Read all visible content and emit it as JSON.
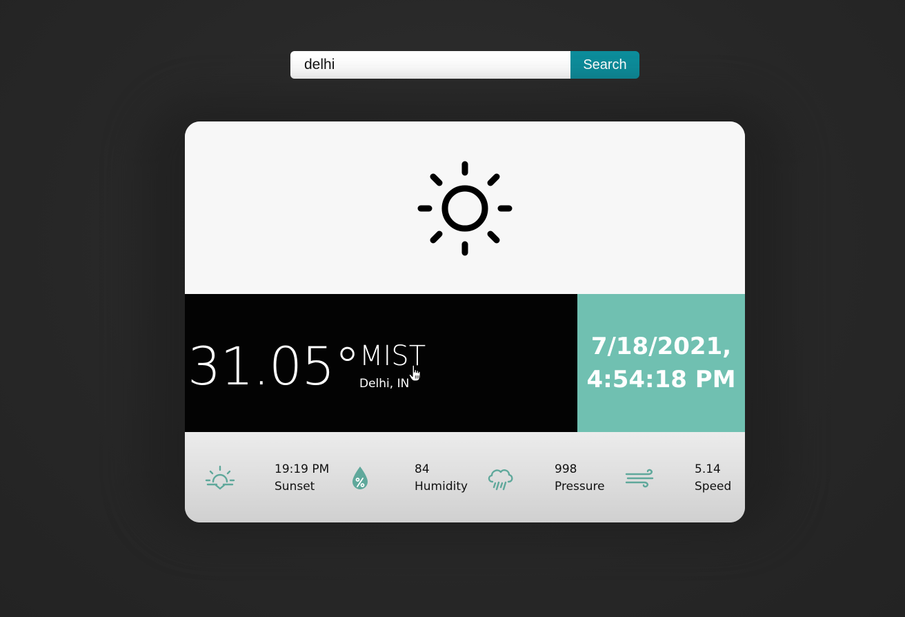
{
  "search": {
    "value": "delhi",
    "button_label": "Search"
  },
  "weather": {
    "icon": "sun-icon",
    "temperature": "31.05°",
    "condition": "MIST",
    "location": "Delhi, IN",
    "date": "7/18/2021,",
    "time": "4:54:18 PM"
  },
  "stats": [
    {
      "icon": "sunset-icon",
      "value": "19:19 PM",
      "label": "Sunset"
    },
    {
      "icon": "humidity-icon",
      "value": "84",
      "label": "Humidity"
    },
    {
      "icon": "pressure-icon",
      "value": "998",
      "label": "Pressure"
    },
    {
      "icon": "wind-icon",
      "value": "5.14",
      "label": "Speed"
    }
  ],
  "colors": {
    "background": "#272727",
    "search_button": "#0c8c9a",
    "accent": "#70c0b1",
    "temp_panel": "#030303",
    "stat_icon": "#5fa89b"
  }
}
